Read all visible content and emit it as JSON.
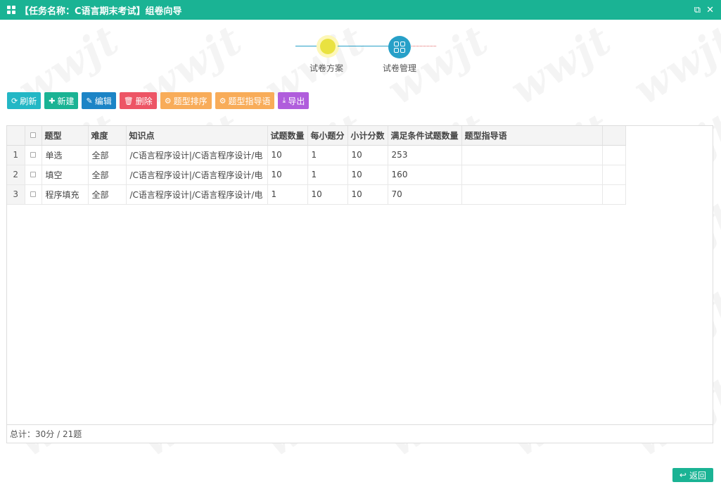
{
  "window": {
    "title": "【任务名称：C语言期末考试】组卷向导"
  },
  "steps": [
    {
      "label": "试卷方案"
    },
    {
      "label": "试卷管理"
    }
  ],
  "toolbar": {
    "refresh": "刷新",
    "new": "新建",
    "edit": "编辑",
    "delete": "删除",
    "sort": "题型排序",
    "guide": "题型指导语",
    "export": "导出"
  },
  "table": {
    "headers": [
      "题型",
      "难度",
      "知识点",
      "试题数量",
      "每小题分",
      "小计分数",
      "满足条件试题数量",
      "题型指导语"
    ],
    "rows": [
      {
        "no": "1",
        "type": "单选",
        "difficulty": "全部",
        "knowledge": "/C语言程序设计|/C语言程序设计/电",
        "count": "10",
        "score": "1",
        "subtotal": "10",
        "available": "253",
        "guide": ""
      },
      {
        "no": "2",
        "type": "填空",
        "difficulty": "全部",
        "knowledge": "/C语言程序设计|/C语言程序设计/电",
        "count": "10",
        "score": "1",
        "subtotal": "10",
        "available": "160",
        "guide": ""
      },
      {
        "no": "3",
        "type": "程序填充",
        "difficulty": "全部",
        "knowledge": "/C语言程序设计|/C语言程序设计/电",
        "count": "1",
        "score": "10",
        "subtotal": "10",
        "available": "70",
        "guide": ""
      }
    ],
    "footer": "总计：30分 / 21题"
  },
  "back": {
    "label": "返回"
  }
}
